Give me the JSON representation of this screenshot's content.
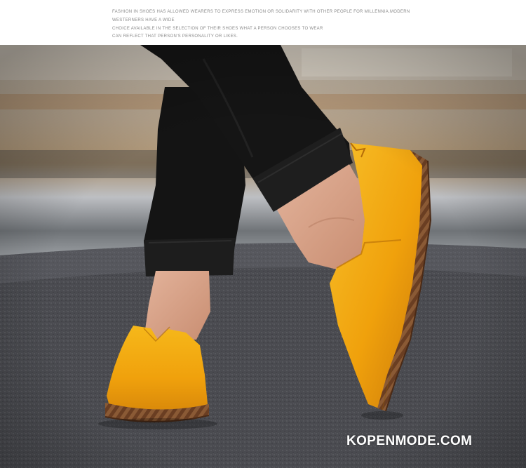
{
  "caption": {
    "lines": [
      "FASHION IN SHOES HAS ALLOWED WEARERS TO EXPRESS EMOTION OR SOLIDARITY WITH OTHER PEOPLE FOR MILLENNIA.MODERN",
      "WESTERNERS HAVE A WIDE",
      "CHOICE AVAILABLE IN THE SELECTION OF THEIR SHOES WHAT A PERSON CHOOSES TO WEAR",
      "CAN REFLECT THAT PERSON'S PERSONALITY OR LIKES."
    ]
  },
  "photo": {
    "subject": "yellow-leather-loafers",
    "colors": {
      "leather": "#f2a60f",
      "leather_shadow": "#c9780a",
      "stitching": "#7a4a2a",
      "trousers": "#141414",
      "road": "#4a4a4e",
      "background_blur": "#b8a690"
    }
  },
  "watermark": {
    "text": "KOPENMODE.COM"
  }
}
